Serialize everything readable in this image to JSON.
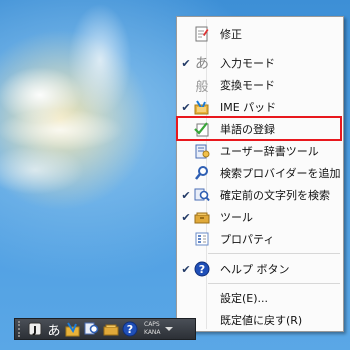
{
  "menu": {
    "items": [
      {
        "label": "修正",
        "checked": false,
        "icon": "correct-icon"
      },
      {
        "label": "入力モード",
        "checked": true,
        "icon": "hiragana-a-icon"
      },
      {
        "label": "変換モード",
        "checked": false,
        "icon": "conversion-mode-icon"
      },
      {
        "label": "IME パッド",
        "checked": true,
        "icon": "ime-pad-icon"
      },
      {
        "label": "単語の登録",
        "checked": false,
        "icon": "word-register-icon"
      },
      {
        "label": "ユーザー辞書ツール",
        "checked": false,
        "icon": "user-dictionary-icon"
      },
      {
        "label": "検索プロバイダーを追加",
        "checked": false,
        "icon": "search-provider-icon"
      },
      {
        "label": "確定前の文字列を検索",
        "checked": true,
        "icon": "search-before-confirm-icon"
      },
      {
        "label": "ツール",
        "checked": true,
        "icon": "tools-icon"
      },
      {
        "label": "プロパティ",
        "checked": false,
        "icon": "properties-icon"
      },
      {
        "label": "ヘルプ ボタン",
        "checked": true,
        "icon": "help-icon"
      },
      {
        "label": "設定(E)...",
        "checked": false,
        "icon": ""
      },
      {
        "label": "既定値に戻す(R)",
        "checked": false,
        "icon": ""
      }
    ],
    "check_mark": "✔",
    "highlighted_item": "単語の登録"
  },
  "tray": {
    "ime_mode": "あ",
    "caps": "CAPS",
    "kana": "KANA"
  },
  "colors": {
    "highlight_border": "#e8181d",
    "menu_bg": "#fbfbfb"
  }
}
